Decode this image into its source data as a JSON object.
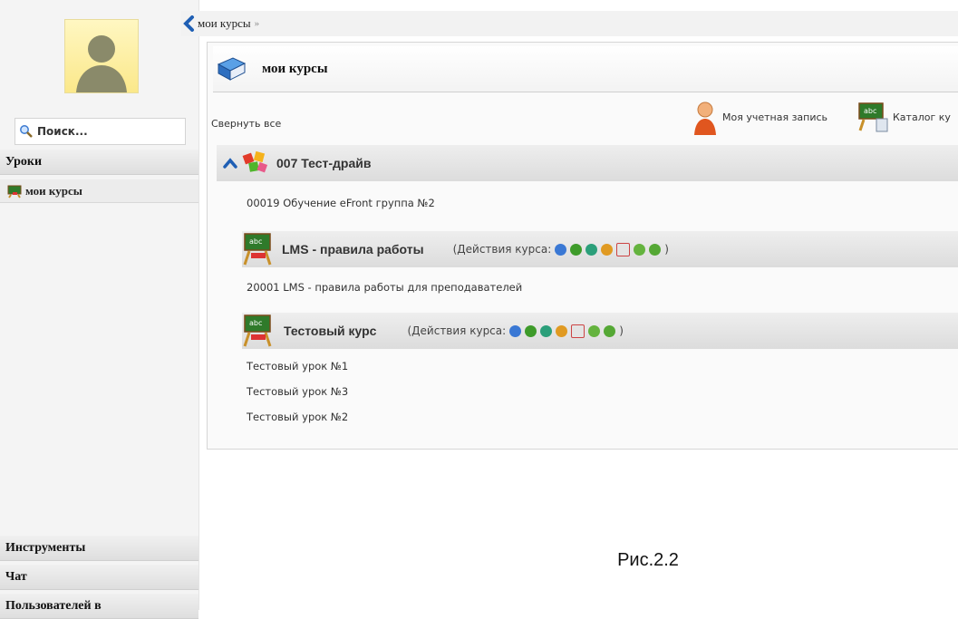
{
  "sidebar": {
    "search_placeholder": "Поиск...",
    "lessons_header": "Уроки",
    "my_courses_item": "мои курсы",
    "tools_header": "Инструменты",
    "chat_header": "Чат",
    "users_header": "Пользователей в"
  },
  "breadcrumb": {
    "label": "мои курсы",
    "sep": "»"
  },
  "panel": {
    "title": "мои курсы",
    "collapse_all": "Свернуть все",
    "account_link": "Моя учетная запись",
    "catalog_link": "Каталог ку"
  },
  "groups": [
    {
      "name": "007 Тест-драйв",
      "subtitle": "00019 Обучение eFront группа №2",
      "courses": [
        {
          "name": "LMS - правила работы",
          "actions_label": "(Действия курса:",
          "actions_close": ")",
          "lessons": [
            "20001 LMS - правила работы для преподавателей"
          ]
        },
        {
          "name": "Тестовый курс",
          "actions_label": "(Действия курса:",
          "actions_close": ")",
          "lessons": [
            "Тестовый урок №1",
            "Тестовый урок №3",
            "Тестовый урок №2"
          ]
        }
      ]
    }
  ],
  "caption": "Рис.2.2",
  "colors": {
    "accent_blue": "#1f5fb4",
    "action_green": "#3e9b2a"
  }
}
